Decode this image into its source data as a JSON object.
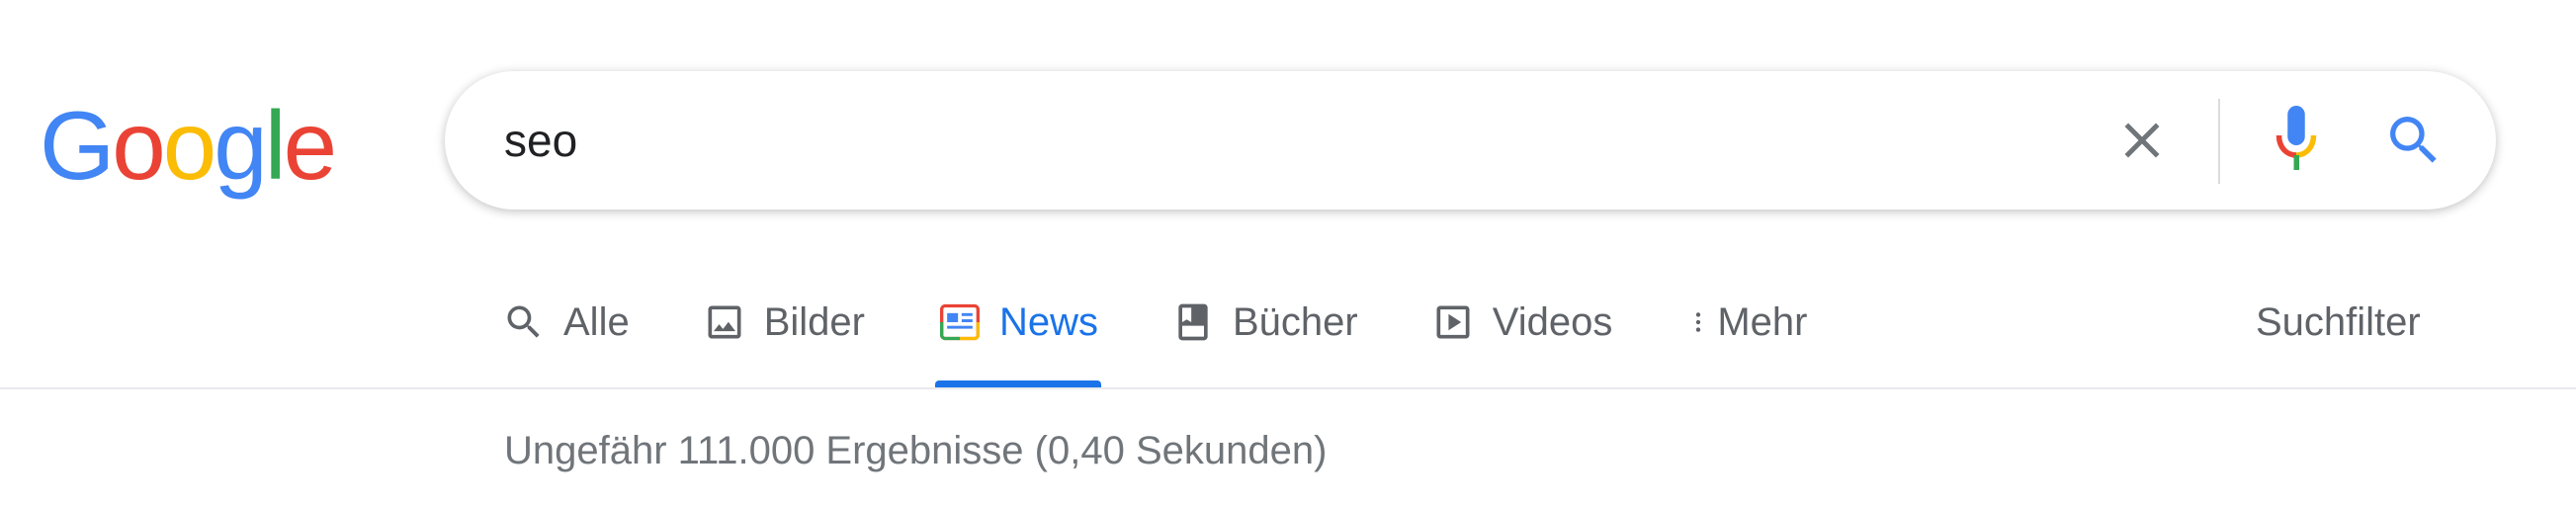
{
  "logo": {
    "letters": [
      {
        "char": "G",
        "color": "#4285f4"
      },
      {
        "char": "o",
        "color": "#ea4335"
      },
      {
        "char": "o",
        "color": "#fbbc05"
      },
      {
        "char": "g",
        "color": "#4285f4"
      },
      {
        "char": "l",
        "color": "#34a853"
      },
      {
        "char": "e",
        "color": "#ea4335"
      }
    ]
  },
  "search": {
    "value": "seo",
    "clear_icon": "close-icon",
    "mic_icon": "microphone-icon",
    "submit_icon": "magnifier-icon"
  },
  "tabs": [
    {
      "label": "Alle",
      "icon": "search-icon",
      "active": false
    },
    {
      "label": "Bilder",
      "icon": "image-icon",
      "active": false
    },
    {
      "label": "News",
      "icon": "news-icon",
      "active": true
    },
    {
      "label": "Bücher",
      "icon": "book-icon",
      "active": false
    },
    {
      "label": "Videos",
      "icon": "play-icon",
      "active": false
    },
    {
      "label": "Mehr",
      "icon": "more-vert-icon",
      "active": false
    }
  ],
  "tools": {
    "label": "Suchfilter"
  },
  "result_stats": "Ungefähr 111.000 Ergebnisse (0,40 Sekunden)",
  "colors": {
    "accent": "#1a73e8",
    "text_secondary": "#5f6368",
    "stats_text": "#70757a"
  }
}
